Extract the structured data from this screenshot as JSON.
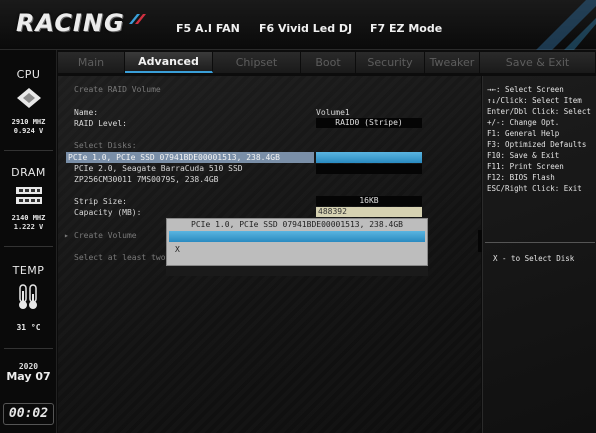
{
  "header": {
    "logo": "RACING",
    "f5": "F5 A.I FAN",
    "f6": "F6 Vivid Led DJ",
    "f7": "F7 EZ Mode"
  },
  "tabs": [
    {
      "label": "Main",
      "active": false
    },
    {
      "label": "Advanced",
      "active": true
    },
    {
      "label": "Chipset",
      "active": false
    },
    {
      "label": "Boot",
      "active": false
    },
    {
      "label": "Security",
      "active": false
    },
    {
      "label": "Tweaker",
      "active": false
    },
    {
      "label": "Save & Exit",
      "active": false
    }
  ],
  "sidebar": {
    "cpu_title": "CPU",
    "cpu_freq": "2910 MHZ",
    "cpu_volt": "0.924 V",
    "dram_title": "DRAM",
    "dram_freq": "2140 MHZ",
    "dram_volt": "1.222 V",
    "temp_title": "TEMP",
    "temp_val": "31 °C",
    "year": "2020",
    "date": "May 07",
    "clock": "00:02"
  },
  "main": {
    "section_title": "Create RAID Volume",
    "name_label": "Name:",
    "name_value": "Volume1",
    "raid_level_label": "RAID Level:",
    "raid_level_value": "RAID0 (Stripe)",
    "select_disks_label": "Select Disks:",
    "disks": [
      "PCIe 1.0, PCIe SSD 07941BDE00001513, 238.4GB",
      "PCIe 2.0, Seagate BarraCuda 510 SSD",
      "ZP256CM30011 7MS0079S, 238.4GB"
    ],
    "strip_size_label": "Strip Size:",
    "strip_size_value": "16KB",
    "capacity_label": "Capacity (MB):",
    "capacity_value": "488392",
    "create_volume": "Create Volume",
    "note": "Select at least two disks"
  },
  "popup": {
    "title": "PCIe 1.0, PCIe SSD 07941BDE00001513, 238.4GB",
    "option": "X"
  },
  "help": {
    "lines": [
      "→←: Select Screen",
      "↑↓/Click: Select Item",
      "Enter/Dbl Click: Select",
      "+/-: Change Opt.",
      "F1: General Help",
      "F3: Optimized Defaults",
      "F10: Save & Exit",
      "F11: Print Screen",
      "F12: BIOS Flash",
      "ESC/Right Click: Exit"
    ],
    "item_help": "X - to Select Disk"
  },
  "colors": {
    "accent_blue": "#3a9fd8",
    "highlight": "#7a8fa8",
    "capacity_bg": "#d6d2b2"
  }
}
